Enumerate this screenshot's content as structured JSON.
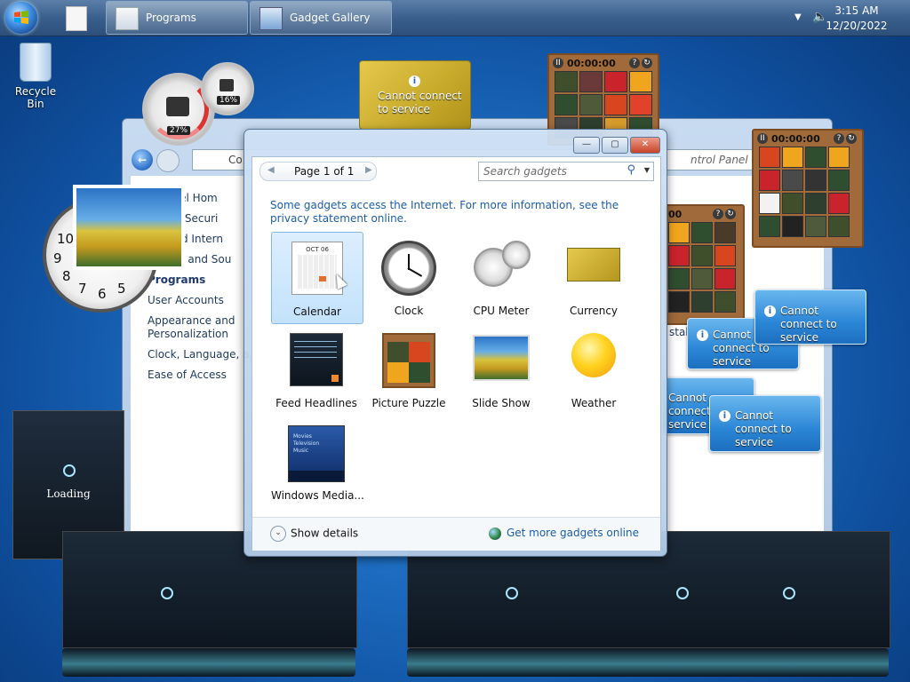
{
  "taskbar": {
    "tasks": [
      {
        "label": "Programs"
      },
      {
        "label": "Gadget Gallery"
      }
    ],
    "clock_time": "3:15 AM",
    "clock_date": "12/20/2022"
  },
  "desktop": {
    "recycle_bin_label": "Recycle Bin",
    "cpu_meter": {
      "cpu_percent": "27%",
      "memory_percent": "16%"
    },
    "cannot_connect": "Cannot connect to service",
    "puzzle_timer": "00:00:00",
    "loading_label": "Loading"
  },
  "control_panel": {
    "address": "Co",
    "search_placeholder": "ntrol Panel",
    "links": [
      {
        "label": "ol Panel Hom"
      },
      {
        "label": "m and Securi"
      },
      {
        "label": "ork and Intern"
      },
      {
        "label": "rdware and Sou"
      },
      {
        "label": "Programs"
      },
      {
        "label": "User Accounts"
      },
      {
        "label": "Appearance and"
      },
      {
        "label": "Personalization"
      },
      {
        "label": "Clock, Language, a"
      },
      {
        "label": "Ease of Access"
      }
    ],
    "right_text": "stall"
  },
  "gallery": {
    "pager": "Page 1 of 1",
    "search_placeholder": "Search gadgets",
    "notice": "Some gadgets access the Internet.  For more information, see the privacy statement online.",
    "gadgets": [
      {
        "name": "Calendar"
      },
      {
        "name": "Clock"
      },
      {
        "name": "CPU Meter"
      },
      {
        "name": "Currency"
      },
      {
        "name": "Feed Headlines"
      },
      {
        "name": "Picture Puzzle"
      },
      {
        "name": "Slide Show"
      },
      {
        "name": "Weather"
      },
      {
        "name": "Windows Media..."
      }
    ],
    "show_details": "Show details",
    "get_more": "Get more gadgets online",
    "calendar_month": "OCT 06",
    "media_lines": [
      "Movies",
      "Television",
      "Music"
    ]
  }
}
